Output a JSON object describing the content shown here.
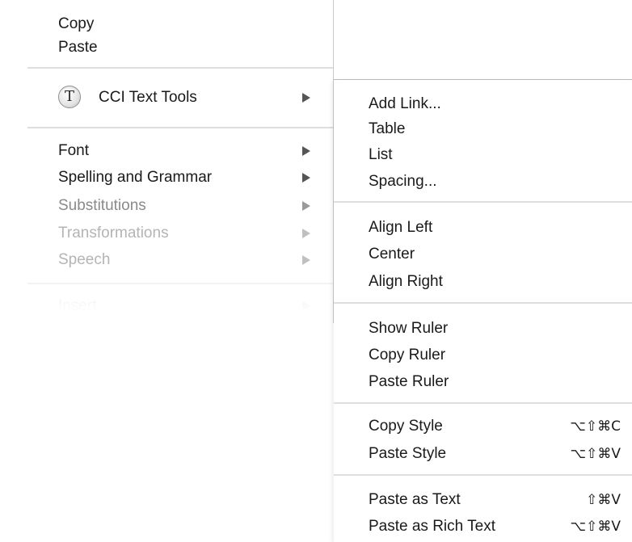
{
  "main_menu": {
    "copy": "Copy",
    "paste": "Paste",
    "cci_text_tools": "CCI Text Tools",
    "cci_icon_glyph": "T",
    "font": "Font",
    "spelling_and_grammar": "Spelling and Grammar",
    "substitutions": "Substitutions",
    "transformations": "Transformations",
    "speech": "Speech",
    "insert": "Insert"
  },
  "submenu": {
    "add_link": "Add Link...",
    "table": "Table",
    "list": "List",
    "spacing": "Spacing...",
    "align_left": "Align Left",
    "center": "Center",
    "align_right": "Align Right",
    "show_ruler": "Show Ruler",
    "copy_ruler": "Copy Ruler",
    "paste_ruler": "Paste Ruler",
    "copy_style": "Copy Style",
    "copy_style_shortcut": "⌥⇧⌘C",
    "paste_style": "Paste Style",
    "paste_style_shortcut": "⌥⇧⌘V",
    "paste_as_text": "Paste as Text",
    "paste_as_text_shortcut": "⇧⌘V",
    "paste_as_rich_text": "Paste as Rich Text",
    "paste_as_rich_text_shortcut": "⌥⇧⌘V"
  }
}
